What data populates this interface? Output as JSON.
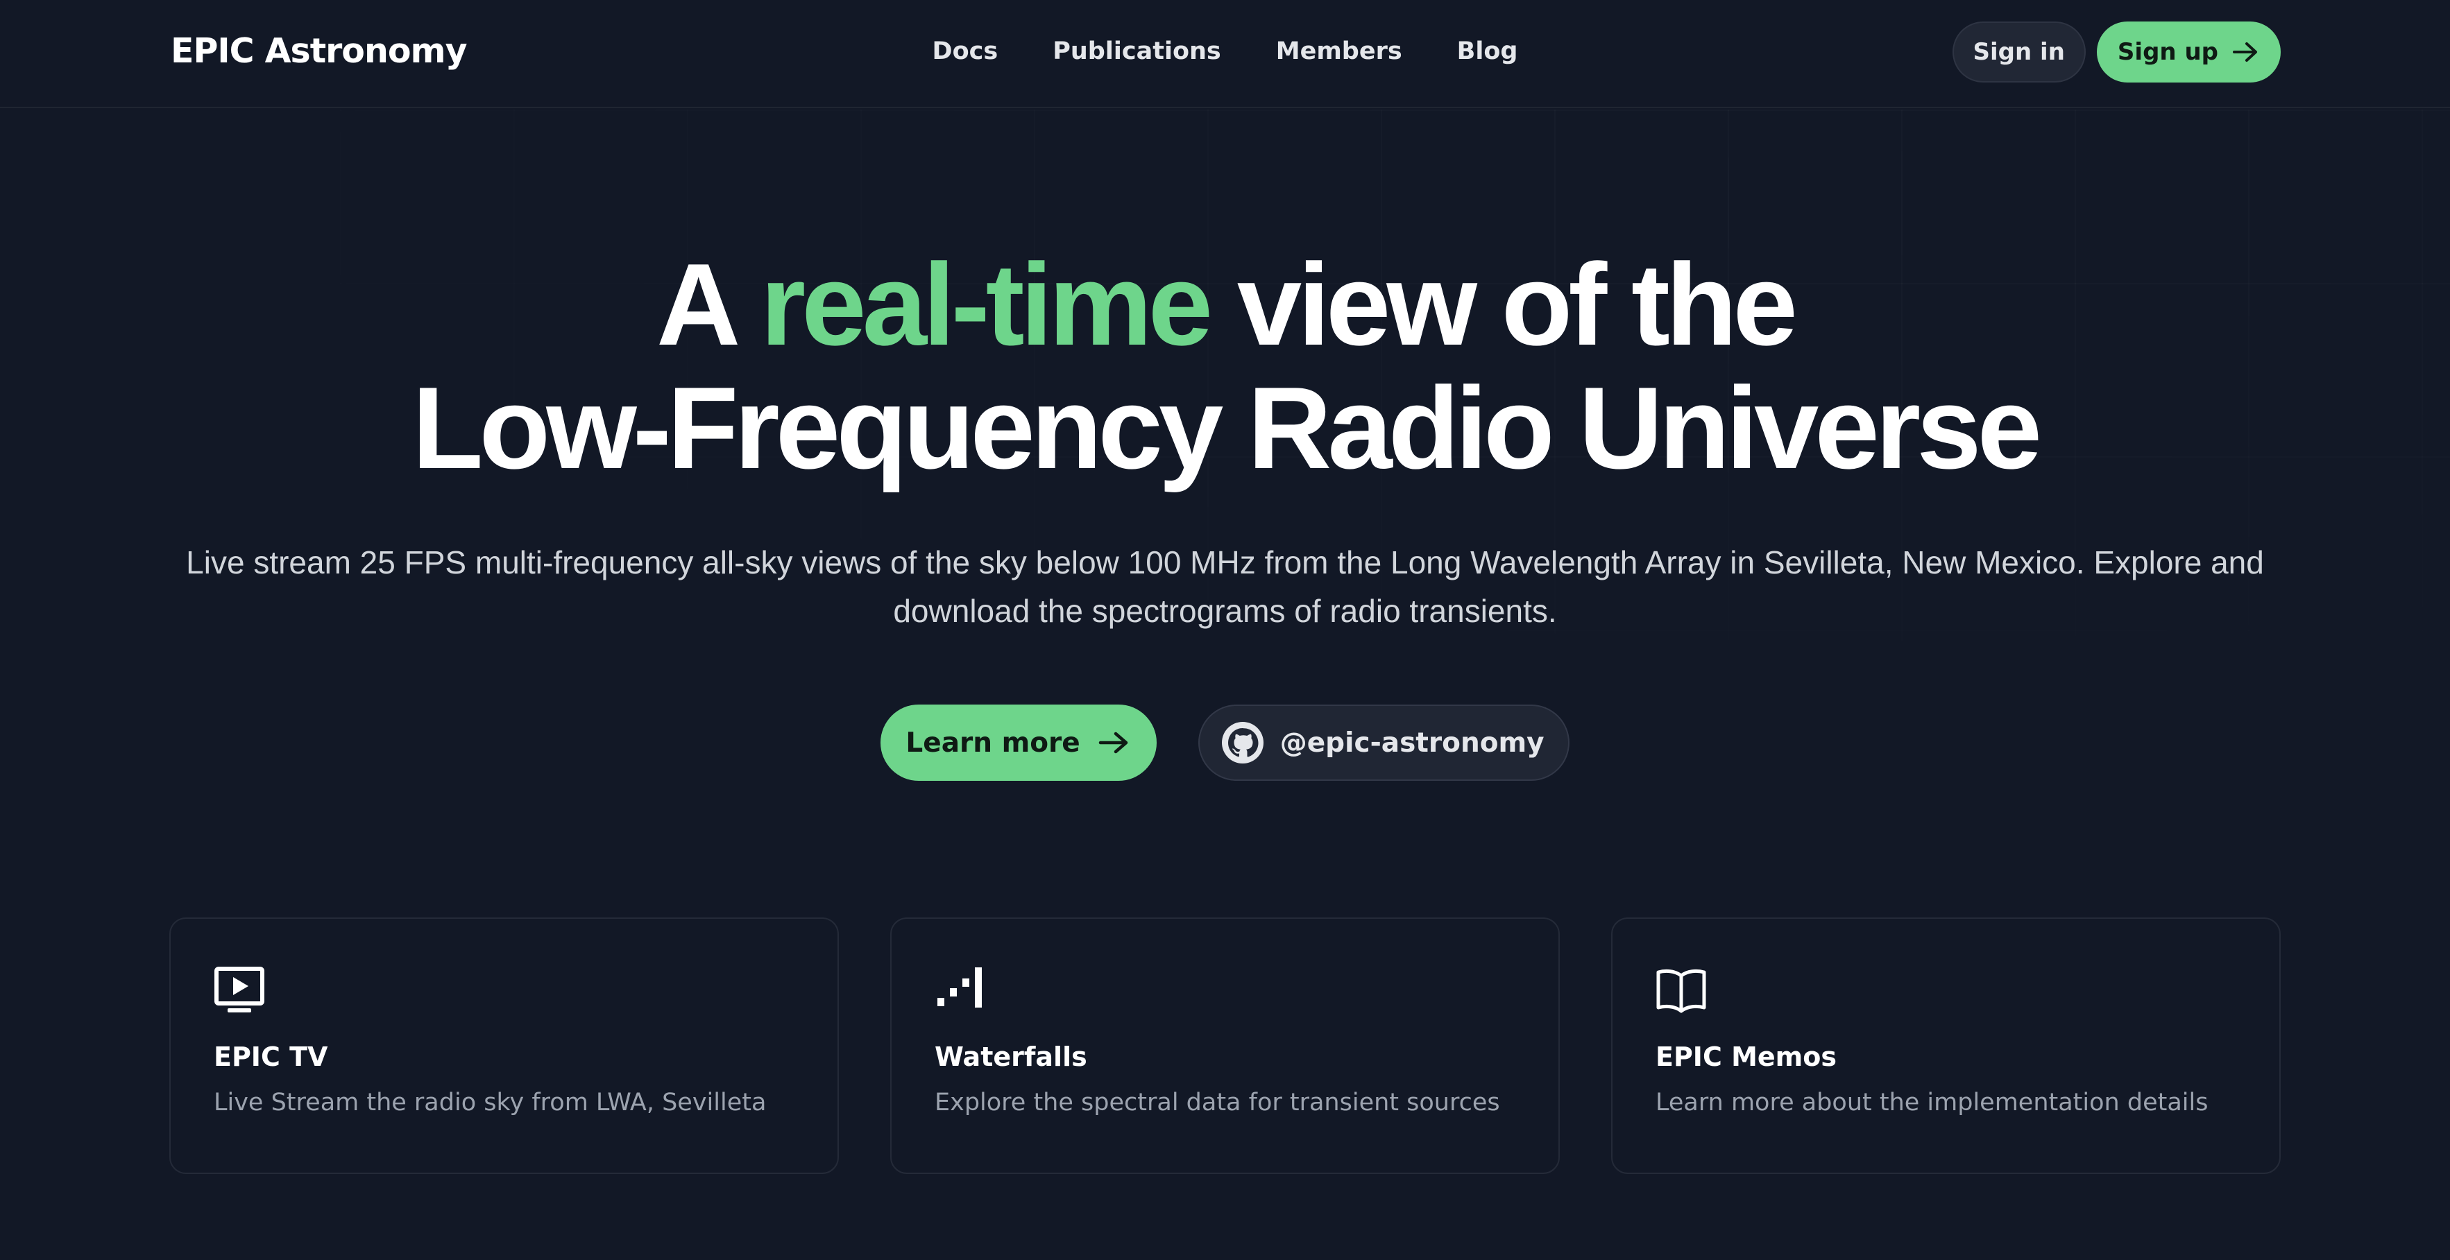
{
  "brand": "EPIC Astronomy",
  "nav": {
    "items": [
      {
        "label": "Docs"
      },
      {
        "label": "Publications"
      },
      {
        "label": "Members"
      },
      {
        "label": "Blog"
      }
    ]
  },
  "header": {
    "sign_in_label": "Sign in",
    "sign_up_label": "Sign up"
  },
  "hero": {
    "title_part1": "A ",
    "title_accent": "real-time",
    "title_part2": " view of the",
    "title_line2": "Low-Frequency Radio Universe",
    "subtitle": "Live stream 25 FPS multi-frequency all-sky views of the sky below 100 MHz from the Long Wavelength Array in Sevilleta, New Mexico. Explore and download the spectrograms of radio transients.",
    "learn_more_label": "Learn more",
    "github_label": "@epic-astronomy"
  },
  "features": [
    {
      "title": "EPIC TV",
      "description": "Live Stream the radio sky from LWA, Sevilleta",
      "icon": "tv-play-icon"
    },
    {
      "title": "Waterfalls",
      "description": "Explore the spectral data for transient sources",
      "icon": "signal-bars-icon"
    },
    {
      "title": "EPIC Memos",
      "description": "Learn more about the implementation details",
      "icon": "open-book-icon"
    }
  ],
  "colors": {
    "background": "#121826",
    "accent": "#6ed58b",
    "text_muted": "#9ca3af"
  }
}
